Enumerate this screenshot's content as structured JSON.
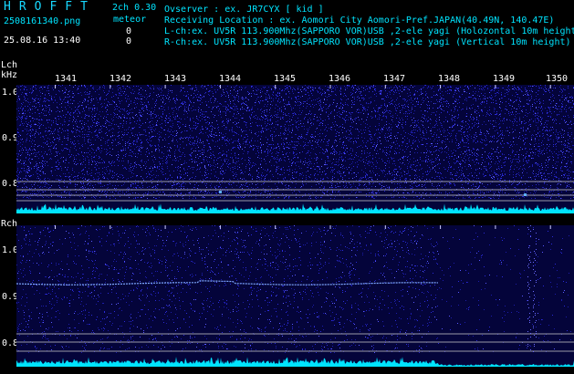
{
  "app": {
    "title": "HROFFT"
  },
  "header": {
    "filename": "2508161340.png",
    "timestamp": "25.08.16 13:40",
    "mode": "2ch 0.30",
    "meteor_label": "meteor",
    "count_l": "0",
    "count_r": "0",
    "info_lines": [
      "Ovserver           : ex. JR7CYX [ kid ]",
      "Receiving Location : ex. Aomori City Aomori-Pref.JAPAN(40.49N, 140.47E)",
      "L-ch:ex. UV5R 113.900Mhz(SAPPORO VOR)USB ,2-ele yagi (Holozontal 10m height",
      "R-ch:ex. UV5R 113.900Mhz(SAPPORO VOR)USB ,2-ele yagi (Vertical 10m height)"
    ]
  },
  "lch": {
    "label": "Lch",
    "unit": "kHz",
    "yticks": [
      "1.0",
      "0.9",
      "0.8"
    ]
  },
  "rch": {
    "label": "Rch",
    "yticks": [
      "1.0",
      "0.9",
      "0.8"
    ]
  },
  "time_axis": [
    "1341",
    "1342",
    "1343",
    "1344",
    "1345",
    "1346",
    "1347",
    "1348",
    "1349",
    "1350"
  ],
  "colors": {
    "background": "#000000",
    "panel": "#04043a",
    "noise": "#2b2bd8",
    "trace": "#00e4ff",
    "gridline": "#9a9aa8",
    "meteor": "#5fb0ff"
  }
}
